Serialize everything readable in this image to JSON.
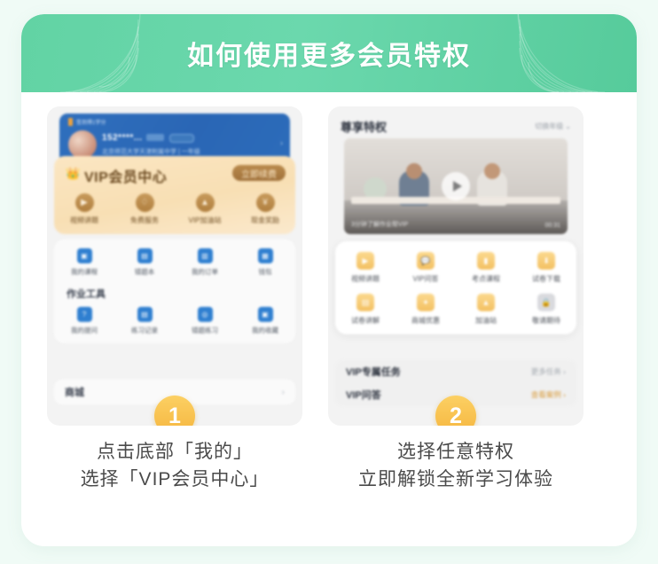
{
  "header": {
    "title": "如何使用更多会员特权"
  },
  "steps": [
    {
      "number": "1",
      "caption_line1": "点击底部「我的」",
      "caption_line2": "选择「VIP会员中心」",
      "profile": {
        "points_text": "签到得1学分",
        "username": "152****...",
        "school": "北京师范大学天津附属中学 | 一年级",
        "arrow": "›"
      },
      "vip": {
        "crown_icon": "crown-icon",
        "title": "VIP会员中心",
        "renew_label": "立即续费",
        "icons": [
          {
            "label": "视频讲题",
            "icon": "video-icon",
            "glyph": "▶"
          },
          {
            "label": "免费服务",
            "icon": "gift-icon",
            "glyph": "♢"
          },
          {
            "label": "VIP加油站",
            "icon": "bell-icon",
            "glyph": "▲"
          },
          {
            "label": "现金奖励",
            "icon": "cash-icon",
            "glyph": "¥"
          }
        ]
      },
      "menu_row1": [
        {
          "label": "我的课程",
          "icon": "course-icon",
          "glyph": "▣"
        },
        {
          "label": "错题本",
          "icon": "notebook-icon",
          "glyph": "▤"
        },
        {
          "label": "我的订单",
          "icon": "order-icon",
          "glyph": "▥"
        },
        {
          "label": "钱包",
          "icon": "wallet-icon",
          "glyph": "▦"
        }
      ],
      "tools_title": "作业工具",
      "menu_row2": [
        {
          "label": "我的提问",
          "icon": "question-icon",
          "glyph": "?"
        },
        {
          "label": "练习记录",
          "icon": "record-icon",
          "glyph": "▤"
        },
        {
          "label": "错题练习",
          "icon": "practice-icon",
          "glyph": "◎"
        },
        {
          "label": "我的收藏",
          "icon": "favorite-icon",
          "glyph": "▣"
        }
      ],
      "mall": {
        "label": "商城",
        "chevron": "›"
      }
    },
    {
      "number": "2",
      "caption_line1": "选择任意特权",
      "caption_line2": "立即解锁全新学习体验",
      "head": {
        "title": "尊享特权",
        "right_label": "切换年级",
        "chevron": "⌄"
      },
      "video": {
        "play_icon": "play-icon",
        "caption": "3分钟了解作业帮VIP",
        "duration": "00:31"
      },
      "privileges_row1": [
        {
          "label": "视频讲题",
          "icon": "video-lesson-icon",
          "glyph": "▶",
          "locked": false
        },
        {
          "label": "VIP问答",
          "icon": "qa-icon",
          "glyph": "💬",
          "locked": false
        },
        {
          "label": "考点课程",
          "icon": "course-icon",
          "glyph": "▮",
          "locked": false
        },
        {
          "label": "试卷下载",
          "icon": "download-icon",
          "glyph": "⬇",
          "locked": false
        }
      ],
      "privileges_row2": [
        {
          "label": "试卷讲解",
          "icon": "paper-explain-icon",
          "glyph": "▤",
          "locked": false
        },
        {
          "label": "商城优惠",
          "icon": "coupon-icon",
          "glyph": "✦",
          "locked": false
        },
        {
          "label": "加油站",
          "icon": "bell-icon",
          "glyph": "▲",
          "locked": false
        },
        {
          "label": "敬请期待",
          "icon": "lock-icon",
          "glyph": "🔒",
          "locked": true
        }
      ],
      "task_rows": [
        {
          "title": "VIP专属任务",
          "action": "更多任务 ›",
          "highlight": false
        },
        {
          "title": "VIP问答",
          "action": "查看案例 ›",
          "highlight": true
        }
      ]
    }
  ],
  "colors": {
    "header_green": "#62d3a4",
    "badge_orange": "#f5b53e",
    "vip_gold": "#fbe6c2",
    "profile_blue": "#2f6fbd",
    "page_bg": "#f0fbf6"
  }
}
